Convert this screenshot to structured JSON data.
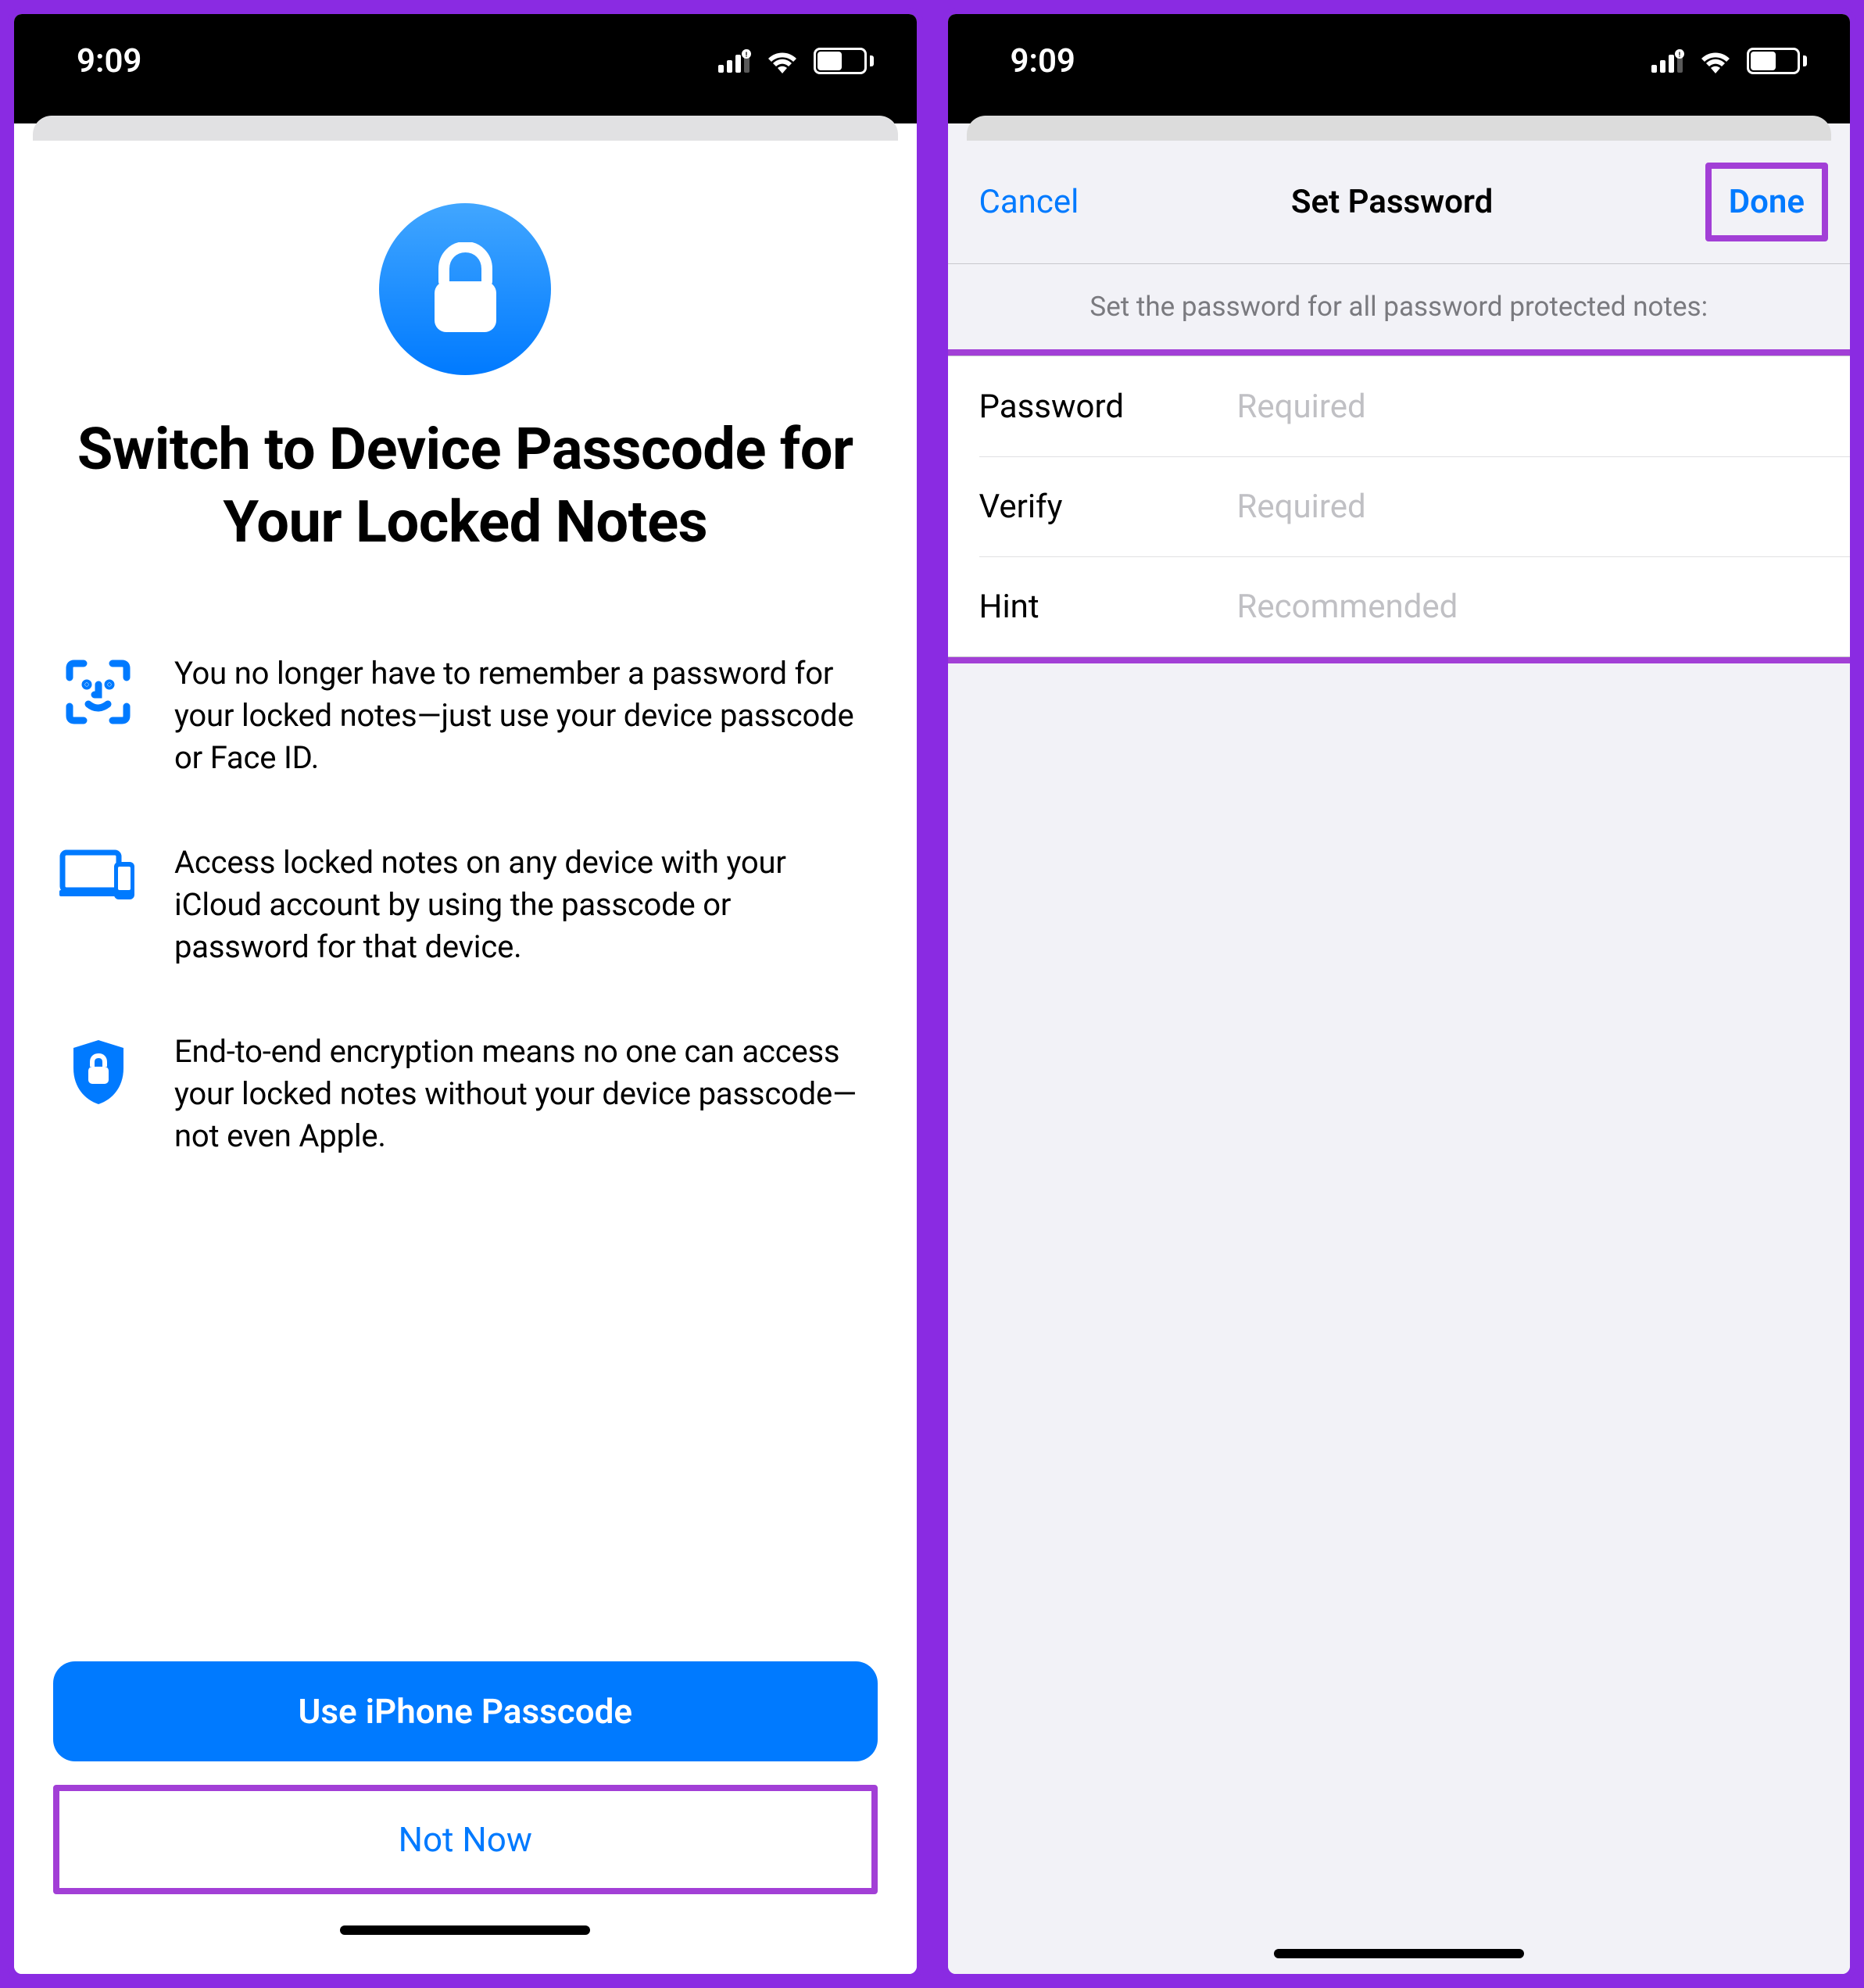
{
  "status": {
    "time": "9:09",
    "battery": "51"
  },
  "left": {
    "title": "Switch to Device Passcode for Your Locked Notes",
    "features": [
      {
        "icon": "faceid-icon",
        "text": "You no longer have to remember a password for your locked notes—just use your device passcode or Face ID."
      },
      {
        "icon": "devices-icon",
        "text": "Access locked notes on any device with your iCloud account by using the passcode or password for that device."
      },
      {
        "icon": "shield-lock-icon",
        "text": "End-to-end encryption means no one can access your locked notes without your device passcode—not even Apple."
      }
    ],
    "primary_button": "Use iPhone Passcode",
    "secondary_button": "Not Now"
  },
  "right": {
    "nav_cancel": "Cancel",
    "nav_title": "Set Password",
    "nav_done": "Done",
    "caption": "Set the password for all password protected notes:",
    "fields": [
      {
        "label": "Password",
        "placeholder": "Required"
      },
      {
        "label": "Verify",
        "placeholder": "Required"
      },
      {
        "label": "Hint",
        "placeholder": "Recommended"
      }
    ]
  },
  "colors": {
    "accent": "#007aff",
    "highlight": "#a23fd6"
  }
}
